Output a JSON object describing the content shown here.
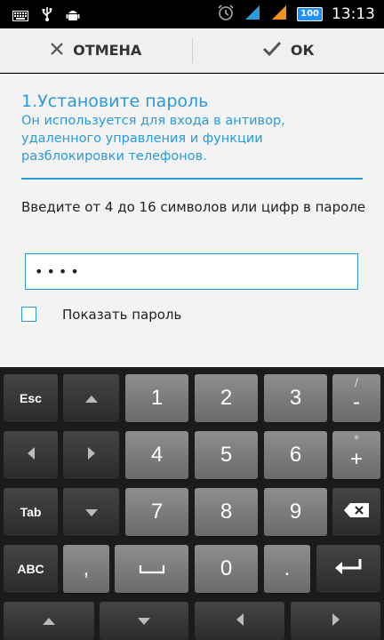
{
  "status_bar": {
    "time": "13:13",
    "battery_label": "100"
  },
  "action_bar": {
    "cancel_label": "ОТМЕНА",
    "ok_label": "ОК"
  },
  "form": {
    "title": "1.Установите пароль",
    "description": "Он используется для входа в антивор, удаленного управления и функции разблокировки телефонов.",
    "instruction": "Введите от 4 до 16 символов или цифр в пароле",
    "password_value": "••••",
    "show_password_label": "Показать пароль",
    "show_password_checked": false
  },
  "keyboard": {
    "esc": "Esc",
    "tab": "Tab",
    "abc": "ABC",
    "digits": [
      "1",
      "2",
      "3",
      "4",
      "5",
      "6",
      "7",
      "8",
      "9",
      "0"
    ],
    "minus": "-",
    "minus_sub": "/",
    "plus": "+",
    "plus_sub": "*",
    "comma": ",",
    "period": ".",
    "space_glyph": "⎵"
  },
  "colors": {
    "accent": "#2a9ad8",
    "background": "#f3f3f3",
    "action_bar": "#f0f0f0",
    "keyboard_bg": "#1b1b1b"
  }
}
